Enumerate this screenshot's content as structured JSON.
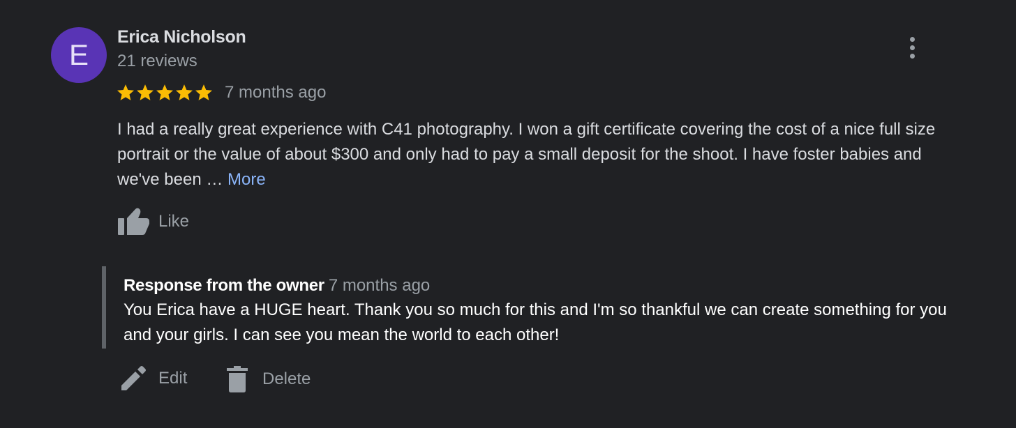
{
  "review": {
    "author": {
      "initial": "E",
      "name": "Erica Nicholson",
      "review_count": "21 reviews",
      "avatar_color": "#5934b5"
    },
    "rating": {
      "value": 5,
      "max": 5,
      "icon": "star-icon",
      "color": "#fbbc04"
    },
    "date": "7 months ago",
    "text": "I had a really great experience with C41 photography. I won a gift certificate covering the cost of a nice full size portrait or the value of about $300 and only had to pay a small deposit for the shoot. I have foster babies and we've been … ",
    "more_label": "More",
    "like_label": "Like",
    "menu_icon": "more-vertical-icon"
  },
  "owner_response": {
    "title": "Response from the owner",
    "date": "7 months ago",
    "text": "You Erica have a HUGE heart. Thank you so much for this and I'm so thankful we can create something for you and your girls. I can see you mean the world to each other!"
  },
  "actions": {
    "edit_label": "Edit",
    "delete_label": "Delete"
  },
  "colors": {
    "background": "#202124",
    "link": "#8ab4f8",
    "secondary_text": "#9aa0a6"
  }
}
